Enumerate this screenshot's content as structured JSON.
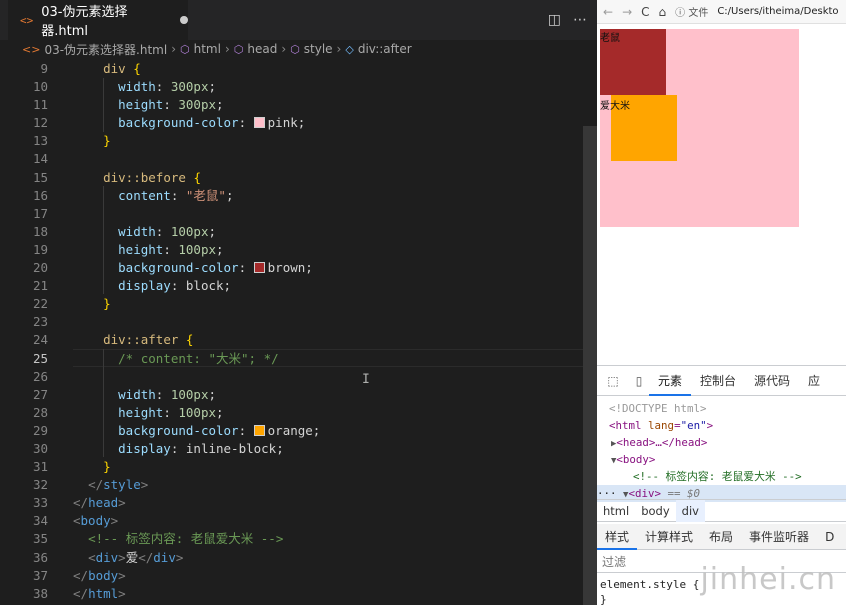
{
  "editor": {
    "tab": {
      "title": "03-伪元素选择器.html",
      "file_icon": "<>"
    },
    "actions": {
      "split": "◫",
      "more": "⋯"
    },
    "breadcrumb": [
      "03-伪元素选择器.html",
      "html",
      "head",
      "style",
      "div::after"
    ],
    "line_numbers": [
      "9",
      "10",
      "11",
      "12",
      "13",
      "14",
      "15",
      "16",
      "17",
      "18",
      "19",
      "20",
      "21",
      "22",
      "23",
      "24",
      "25",
      "26",
      "27",
      "28",
      "29",
      "30",
      "31",
      "32",
      "33",
      "34",
      "35",
      "36",
      "37",
      "38"
    ],
    "active_line": "25",
    "swatches": {
      "pink": "#ffc0cb",
      "brown": "#a52a2a",
      "orange": "#ffa500"
    }
  },
  "browser": {
    "nav": {
      "back": "←",
      "forward": "→",
      "reload": "C",
      "home": "⌂"
    },
    "info_label": "文件",
    "url": "C:/Users/itheima/Deskto",
    "before_text": "老鼠",
    "after_text": "爱大米"
  },
  "devtools": {
    "tabs": [
      "元素",
      "控制台",
      "源代码",
      "应"
    ],
    "dom": {
      "doctype": "<!DOCTYPE html>",
      "html_lang": "en",
      "head": "<head>…</head>",
      "body": "<body>",
      "comment": "<!-- 标签内容: 老鼠爱大米 -->",
      "selected": "<div>",
      "selected_suffix": "== $0",
      "dots": "···"
    },
    "crumbs": [
      "html",
      "body",
      "div"
    ],
    "style_tabs": [
      "样式",
      "计算样式",
      "布局",
      "事件监听器",
      "D"
    ],
    "filter_placeholder": "过滤",
    "element_style": "element.style {",
    "closing_brace": "}"
  },
  "watermark": "jinhei.cn"
}
